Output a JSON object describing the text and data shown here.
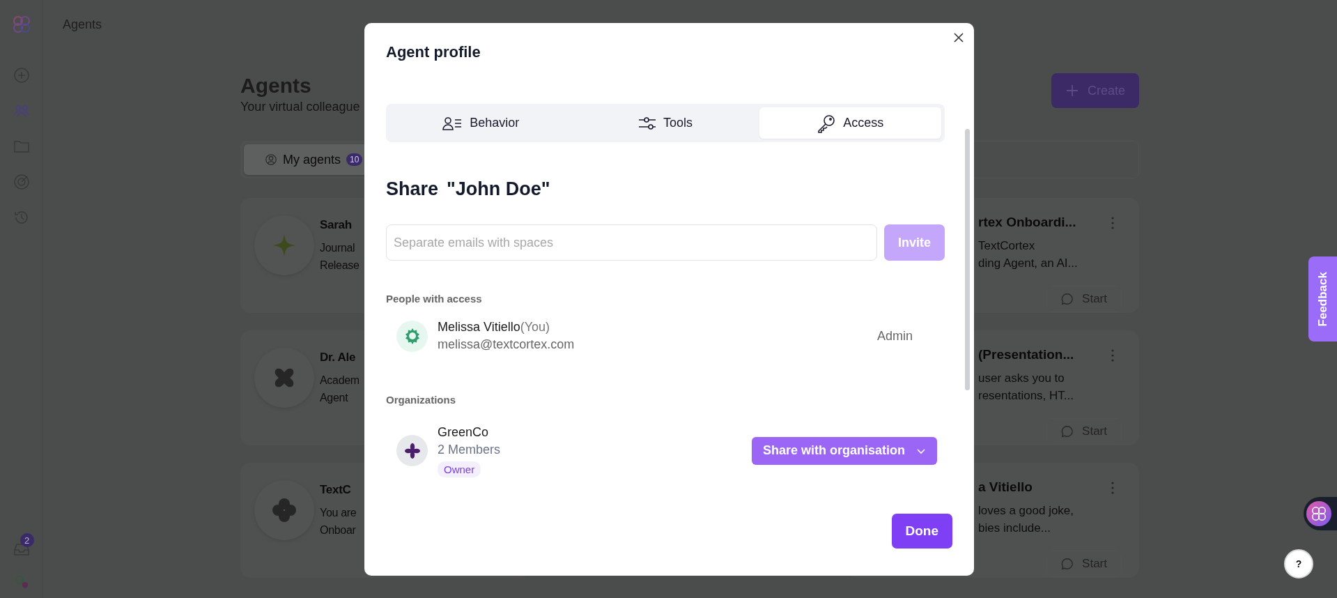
{
  "top_bar": {
    "title": "Agents"
  },
  "sidebar": {
    "inbox_badge": "2"
  },
  "page": {
    "title": "Agents",
    "subtitle": "Your virtual colleague",
    "create_button": "Create",
    "filter_tabs": [
      {
        "label": "My agents",
        "count": "10",
        "selected": true
      }
    ],
    "left_cards": [
      {
        "name": "Sarah",
        "description": [
          "Journal",
          "Release"
        ]
      },
      {
        "name": "Dr. Ale",
        "description": [
          "Academ",
          "Agent"
        ]
      },
      {
        "name": "TextC",
        "description": [
          "You are",
          "Onboar"
        ]
      }
    ],
    "right_cards": [
      {
        "name": "rtex Onboardi...",
        "description": [
          "TextCortex",
          "ding Agent, an AI..."
        ],
        "button": "Start"
      },
      {
        "name": "(Presentation...",
        "description": [
          "user asks you to",
          "resentations, HT..."
        ],
        "button": "Start"
      },
      {
        "name": "a Vitiello",
        "description": [
          "loves a good joke,",
          "bies include..."
        ],
        "button": "Start"
      }
    ]
  },
  "feedback_tab": "Feedback",
  "help_button": "?",
  "modal": {
    "title": "Agent profile",
    "tabs": [
      {
        "label": "Behavior",
        "selected": false
      },
      {
        "label": "Tools",
        "selected": false
      },
      {
        "label": "Access",
        "selected": true
      }
    ],
    "share_label": "Share",
    "agent_name": "\"John Doe\"",
    "invite": {
      "placeholder": "Separate emails with spaces",
      "button": "Invite",
      "disabled": true
    },
    "people_heading": "People with access",
    "people": [
      {
        "name": "Melissa Vitiello",
        "note": "(You)",
        "email": "melissa@textcortex.com",
        "role": "Admin"
      }
    ],
    "organizations_heading": "Organizations",
    "organizations": [
      {
        "name": "GreenCo",
        "members": "2 Members",
        "badge": "Owner",
        "action": "Share with organisation"
      }
    ],
    "done_button": "Done"
  }
}
